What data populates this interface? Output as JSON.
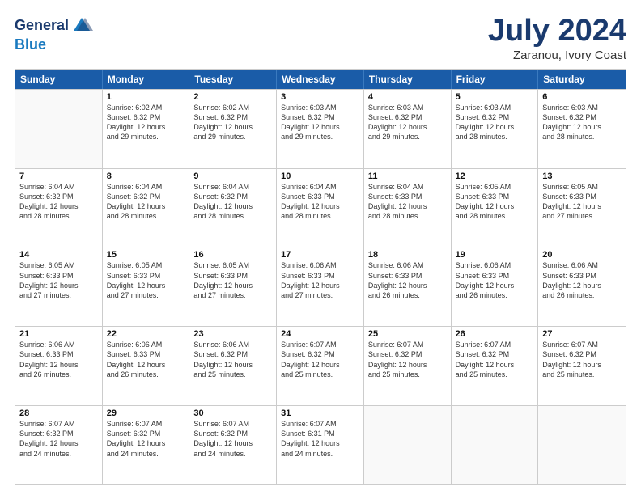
{
  "logo": {
    "line1": "General",
    "line2": "Blue"
  },
  "title": "July 2024",
  "subtitle": "Zaranou, Ivory Coast",
  "header_days": [
    "Sunday",
    "Monday",
    "Tuesday",
    "Wednesday",
    "Thursday",
    "Friday",
    "Saturday"
  ],
  "weeks": [
    [
      {
        "day": "",
        "text": ""
      },
      {
        "day": "1",
        "text": "Sunrise: 6:02 AM\nSunset: 6:32 PM\nDaylight: 12 hours\nand 29 minutes."
      },
      {
        "day": "2",
        "text": "Sunrise: 6:02 AM\nSunset: 6:32 PM\nDaylight: 12 hours\nand 29 minutes."
      },
      {
        "day": "3",
        "text": "Sunrise: 6:03 AM\nSunset: 6:32 PM\nDaylight: 12 hours\nand 29 minutes."
      },
      {
        "day": "4",
        "text": "Sunrise: 6:03 AM\nSunset: 6:32 PM\nDaylight: 12 hours\nand 29 minutes."
      },
      {
        "day": "5",
        "text": "Sunrise: 6:03 AM\nSunset: 6:32 PM\nDaylight: 12 hours\nand 28 minutes."
      },
      {
        "day": "6",
        "text": "Sunrise: 6:03 AM\nSunset: 6:32 PM\nDaylight: 12 hours\nand 28 minutes."
      }
    ],
    [
      {
        "day": "7",
        "text": "Sunrise: 6:04 AM\nSunset: 6:32 PM\nDaylight: 12 hours\nand 28 minutes."
      },
      {
        "day": "8",
        "text": "Sunrise: 6:04 AM\nSunset: 6:32 PM\nDaylight: 12 hours\nand 28 minutes."
      },
      {
        "day": "9",
        "text": "Sunrise: 6:04 AM\nSunset: 6:32 PM\nDaylight: 12 hours\nand 28 minutes."
      },
      {
        "day": "10",
        "text": "Sunrise: 6:04 AM\nSunset: 6:33 PM\nDaylight: 12 hours\nand 28 minutes."
      },
      {
        "day": "11",
        "text": "Sunrise: 6:04 AM\nSunset: 6:33 PM\nDaylight: 12 hours\nand 28 minutes."
      },
      {
        "day": "12",
        "text": "Sunrise: 6:05 AM\nSunset: 6:33 PM\nDaylight: 12 hours\nand 28 minutes."
      },
      {
        "day": "13",
        "text": "Sunrise: 6:05 AM\nSunset: 6:33 PM\nDaylight: 12 hours\nand 27 minutes."
      }
    ],
    [
      {
        "day": "14",
        "text": "Sunrise: 6:05 AM\nSunset: 6:33 PM\nDaylight: 12 hours\nand 27 minutes."
      },
      {
        "day": "15",
        "text": "Sunrise: 6:05 AM\nSunset: 6:33 PM\nDaylight: 12 hours\nand 27 minutes."
      },
      {
        "day": "16",
        "text": "Sunrise: 6:05 AM\nSunset: 6:33 PM\nDaylight: 12 hours\nand 27 minutes."
      },
      {
        "day": "17",
        "text": "Sunrise: 6:06 AM\nSunset: 6:33 PM\nDaylight: 12 hours\nand 27 minutes."
      },
      {
        "day": "18",
        "text": "Sunrise: 6:06 AM\nSunset: 6:33 PM\nDaylight: 12 hours\nand 26 minutes."
      },
      {
        "day": "19",
        "text": "Sunrise: 6:06 AM\nSunset: 6:33 PM\nDaylight: 12 hours\nand 26 minutes."
      },
      {
        "day": "20",
        "text": "Sunrise: 6:06 AM\nSunset: 6:33 PM\nDaylight: 12 hours\nand 26 minutes."
      }
    ],
    [
      {
        "day": "21",
        "text": "Sunrise: 6:06 AM\nSunset: 6:33 PM\nDaylight: 12 hours\nand 26 minutes."
      },
      {
        "day": "22",
        "text": "Sunrise: 6:06 AM\nSunset: 6:33 PM\nDaylight: 12 hours\nand 26 minutes."
      },
      {
        "day": "23",
        "text": "Sunrise: 6:06 AM\nSunset: 6:32 PM\nDaylight: 12 hours\nand 25 minutes."
      },
      {
        "day": "24",
        "text": "Sunrise: 6:07 AM\nSunset: 6:32 PM\nDaylight: 12 hours\nand 25 minutes."
      },
      {
        "day": "25",
        "text": "Sunrise: 6:07 AM\nSunset: 6:32 PM\nDaylight: 12 hours\nand 25 minutes."
      },
      {
        "day": "26",
        "text": "Sunrise: 6:07 AM\nSunset: 6:32 PM\nDaylight: 12 hours\nand 25 minutes."
      },
      {
        "day": "27",
        "text": "Sunrise: 6:07 AM\nSunset: 6:32 PM\nDaylight: 12 hours\nand 25 minutes."
      }
    ],
    [
      {
        "day": "28",
        "text": "Sunrise: 6:07 AM\nSunset: 6:32 PM\nDaylight: 12 hours\nand 24 minutes."
      },
      {
        "day": "29",
        "text": "Sunrise: 6:07 AM\nSunset: 6:32 PM\nDaylight: 12 hours\nand 24 minutes."
      },
      {
        "day": "30",
        "text": "Sunrise: 6:07 AM\nSunset: 6:32 PM\nDaylight: 12 hours\nand 24 minutes."
      },
      {
        "day": "31",
        "text": "Sunrise: 6:07 AM\nSunset: 6:31 PM\nDaylight: 12 hours\nand 24 minutes."
      },
      {
        "day": "",
        "text": ""
      },
      {
        "day": "",
        "text": ""
      },
      {
        "day": "",
        "text": ""
      }
    ]
  ]
}
